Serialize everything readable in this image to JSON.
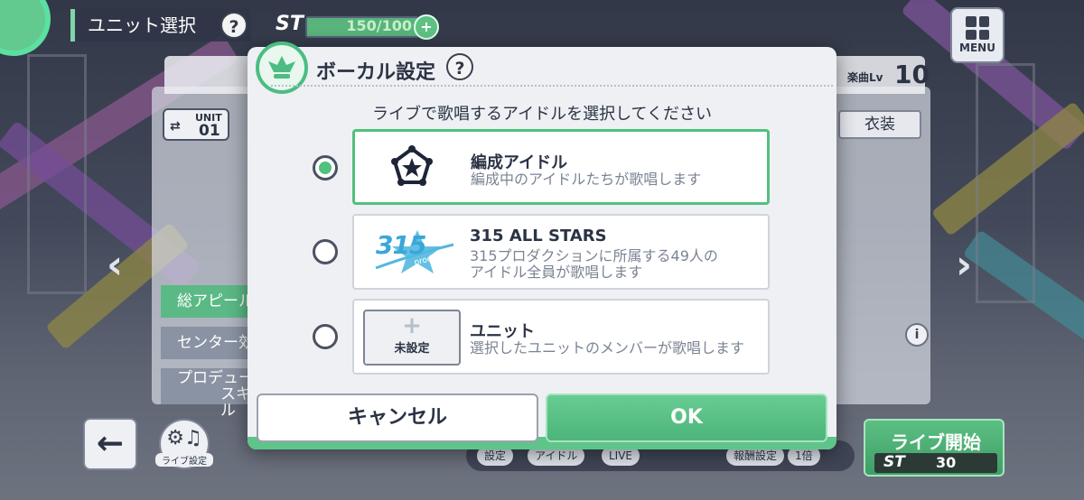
{
  "header": {
    "title": "ユニット選択",
    "help_icon": "?",
    "stamina_label": "ST",
    "stamina_text": "150/100",
    "stamina_fraction": 1.0,
    "stamina_plus": "+",
    "menu_label": "MENU"
  },
  "background": {
    "song_level_label": "楽曲Lv",
    "song_level_value": "10",
    "unit_chip_top": "UNIT",
    "unit_chip_num": "01",
    "costume_label": "衣装",
    "tab_total_appeal": "総アピール",
    "tab_center": "センター効",
    "tab_producer_1": "プロデュー",
    "tab_producer_2": "スキル",
    "live_settings_label": "ライブ設定",
    "strip_items": [
      "設定",
      "アイドル",
      "LIVE",
      "報酬設定",
      "1倍"
    ],
    "start_label": "ライブ開始",
    "start_st_label": "ST",
    "start_st_value": "30",
    "info_icon": "i"
  },
  "modal": {
    "title": "ボーカル設定",
    "help_icon": "?",
    "subtitle": "ライブで歌唱するアイドルを選択してください",
    "options": [
      {
        "title": "編成アイドル",
        "desc": "編成中のアイドルたちが歌唱します",
        "icon": "star-pentagon-icon",
        "selected": true
      },
      {
        "title": "315 ALL STARS",
        "desc_1": "315プロダクションに所属する49人の",
        "desc_2": "アイドル全員が歌唱します",
        "logo_text": "315",
        "logo_sub": "production",
        "selected": false
      },
      {
        "title": "ユニット",
        "desc": "選択したユニットのメンバーが歌唱します",
        "unset_plus": "+",
        "unset_label": "未設定",
        "selected": false
      }
    ],
    "cancel_label": "キャンセル",
    "ok_label": "OK"
  },
  "colors": {
    "accent_green": "#52c07e",
    "text_dark": "#2b3344",
    "text_muted": "#7b8494"
  }
}
